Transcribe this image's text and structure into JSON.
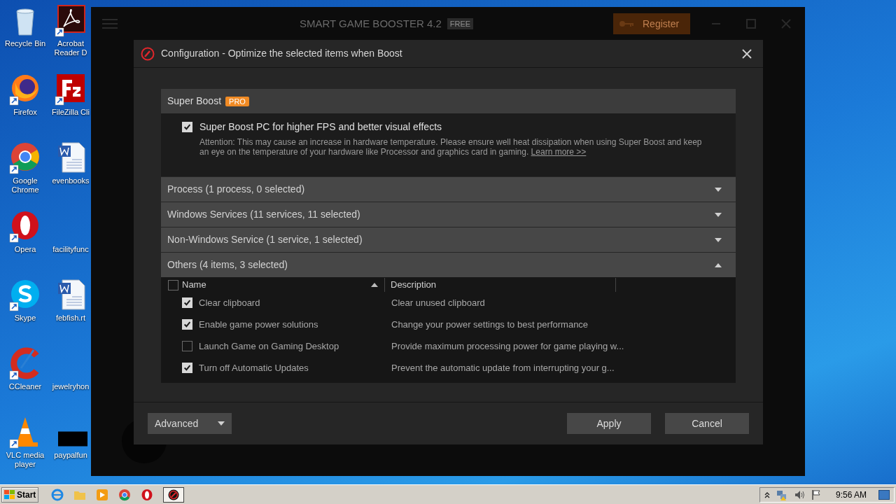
{
  "desktop": {
    "icons": [
      {
        "label": "Recycle Bin",
        "kind": "recycle"
      },
      {
        "label": "Acrobat Reader D",
        "kind": "acrobat"
      },
      {
        "label": "Firefox",
        "kind": "firefox"
      },
      {
        "label": "FileZilla Cli",
        "kind": "filezilla"
      },
      {
        "label": "Google Chrome",
        "kind": "chrome"
      },
      {
        "label": "evenbooks",
        "kind": "word"
      },
      {
        "label": "Opera",
        "kind": "opera"
      },
      {
        "label": "facilityfunc",
        "kind": "blank"
      },
      {
        "label": "Skype",
        "kind": "skype"
      },
      {
        "label": "febfish.rt",
        "kind": "word"
      },
      {
        "label": "CCleaner",
        "kind": "ccleaner"
      },
      {
        "label": "jewelryhon",
        "kind": "blank"
      },
      {
        "label": "VLC media player",
        "kind": "vlc"
      },
      {
        "label": "paypalfun",
        "kind": "blackbox"
      }
    ]
  },
  "app": {
    "title": "SMART GAME BOOSTER 4.2",
    "edition": "FREE",
    "register_button": "Register"
  },
  "dialog": {
    "title": "Configuration - Optimize the selected items when Boost",
    "super_boost": {
      "title": "Super Boost",
      "badge": "PRO",
      "option": {
        "label": "Super Boost PC for higher FPS and better visual effects",
        "checked": true
      },
      "attention": "Attention: This may cause an increase in hardware temperature. Please ensure well heat dissipation when using Super Boost and keep an eye on the temperature of your hardware like Processor and graphics card in gaming.",
      "link": "Learn more >>"
    },
    "sections": [
      {
        "title": "Process (1 process, 0 selected)",
        "expanded": false
      },
      {
        "title": "Windows Services (11 services, 11 selected)",
        "expanded": false
      },
      {
        "title": "Non-Windows Service (1 service, 1 selected)",
        "expanded": false
      },
      {
        "title": "Others (4 items, 3 selected)",
        "expanded": true
      }
    ],
    "table": {
      "header_checked": false,
      "columns": [
        "Name",
        "Description"
      ],
      "rows": [
        {
          "name": "Clear clipboard",
          "description": "Clear unused clipboard",
          "checked": true
        },
        {
          "name": "Enable game power solutions",
          "description": "Change your power settings to best performance",
          "checked": true
        },
        {
          "name": "Launch Game on Gaming Desktop",
          "description": "Provide maximum processing power for game playing w...",
          "checked": false
        },
        {
          "name": "Turn off Automatic Updates",
          "description": "Prevent the automatic update from interrupting your g...",
          "checked": true
        }
      ]
    },
    "advanced_button": "Advanced",
    "apply_button": "Apply",
    "cancel_button": "Cancel"
  },
  "taskbar": {
    "start": "Start",
    "clock": "9:56 AM"
  }
}
